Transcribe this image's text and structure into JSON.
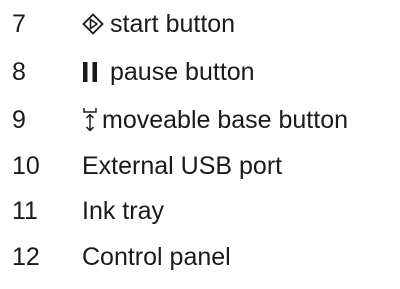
{
  "legend": {
    "items": [
      {
        "number": "7",
        "icon": "start-icon",
        "label": "start button"
      },
      {
        "number": "8",
        "icon": "pause-icon",
        "label": "pause button"
      },
      {
        "number": "9",
        "icon": "moveable-base-icon",
        "label": "moveable base button"
      },
      {
        "number": "10",
        "icon": "",
        "label": "External USB port"
      },
      {
        "number": "11",
        "icon": "",
        "label": "Ink tray"
      },
      {
        "number": "12",
        "icon": "",
        "label": "Control panel"
      }
    ]
  }
}
